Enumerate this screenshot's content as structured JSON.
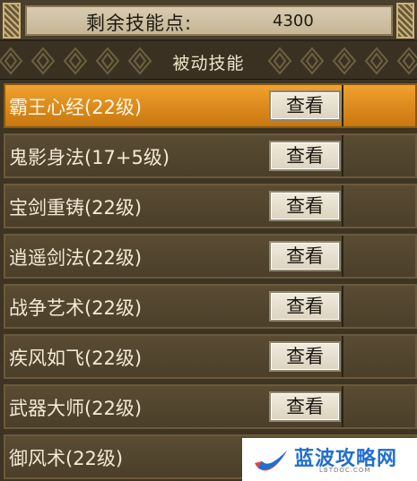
{
  "header": {
    "points_label": "剩余技能点:",
    "points_value": "4300"
  },
  "section": {
    "title": "被动技能"
  },
  "skills": [
    {
      "name": "霸王心经(22级)",
      "button": "查看",
      "selected": true
    },
    {
      "name": "鬼影身法(17+5级)",
      "button": "查看",
      "selected": false
    },
    {
      "name": "宝剑重铸(22级)",
      "button": "查看",
      "selected": false
    },
    {
      "name": "逍遥剑法(22级)",
      "button": "查看",
      "selected": false
    },
    {
      "name": "战争艺术(22级)",
      "button": "查看",
      "selected": false
    },
    {
      "name": "疾风如飞(22级)",
      "button": "查看",
      "selected": false
    },
    {
      "name": "武器大师(22级)",
      "button": "查看",
      "selected": false
    },
    {
      "name": "御风术(22级)",
      "selected": false
    }
  ],
  "watermark": {
    "text": "蓝波攻略网",
    "sub": "LBTDOC.COM",
    "logo_icon": "checkmark-logo-icon"
  },
  "colors": {
    "selected_row": "#e08c1c",
    "row_bg": "#524530",
    "accent_text": "#f2ead6",
    "watermark_blue": "#1f6fd0"
  }
}
